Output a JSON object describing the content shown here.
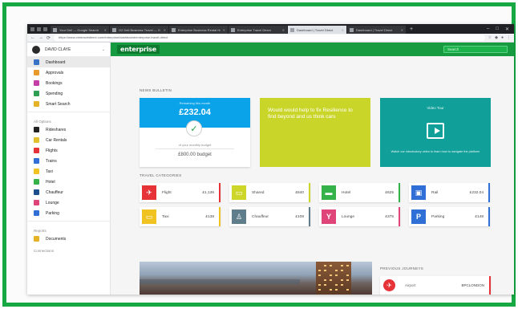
{
  "browser": {
    "tabs": [
      {
        "title": "Your Dell — Google Search",
        "active": false
      },
      {
        "title": "G2 Dell Business Travel — G",
        "active": false
      },
      {
        "title": "Enterprise Business Rental Home",
        "active": false
      },
      {
        "title": "Enterprise Travel Direct",
        "active": false
      },
      {
        "title": "Dashboard | Travel Direct",
        "active": true
      },
      {
        "title": "Dashboard | Travel Direct",
        "active": false
      }
    ],
    "url": "https://www.ctmtraveldirect.com/enterprise/dashboard/enterprise-travel-direct"
  },
  "sidebar": {
    "user_name": "DAVID CLAYE",
    "items": [
      {
        "label": "Dashboard",
        "icon": "dashboard-icon",
        "color": "#3a73c6",
        "active": true
      },
      {
        "label": "Approvals",
        "icon": "approvals-icon",
        "color": "#e89a2a",
        "active": false
      },
      {
        "label": "Bookings",
        "icon": "bookings-icon",
        "color": "#c53ea8",
        "active": false
      },
      {
        "label": "Spending",
        "icon": "spending-icon",
        "color": "#2f9f52",
        "active": false
      },
      {
        "label": "Smart Search",
        "icon": "smart-search-icon",
        "color": "#e6b326",
        "active": false
      }
    ],
    "section_heading": "All Options",
    "options": [
      {
        "label": "Rideshares",
        "icon": "car-icon",
        "color": "#222222"
      },
      {
        "label": "Car Rentals",
        "icon": "car-rental-icon",
        "color": "#e2c02f"
      },
      {
        "label": "Flights",
        "icon": "flight-icon",
        "color": "#e53338"
      },
      {
        "label": "Trains",
        "icon": "train-icon",
        "color": "#2f6fd6"
      },
      {
        "label": "Taxi",
        "icon": "taxi-icon",
        "color": "#f0c323"
      },
      {
        "label": "Hotel",
        "icon": "hotel-icon",
        "color": "#35b24a"
      },
      {
        "label": "Chauffeur",
        "icon": "chauffeur-icon",
        "color": "#1d4f8e"
      },
      {
        "label": "Lounge",
        "icon": "lounge-icon",
        "color": "#e0457a"
      },
      {
        "label": "Parking",
        "icon": "parking-icon",
        "color": "#2f6fd6"
      }
    ],
    "footer_heading": "Reports",
    "footer_items": [
      {
        "label": "Documents",
        "icon": "documents-icon",
        "color": "#e6b326"
      }
    ],
    "bottom_heading": "Connections"
  },
  "topbar": {
    "brand": "enterprise",
    "search_placeholder": "Search"
  },
  "main": {
    "overview_title": "NEWS BULLETIN",
    "budget": {
      "label": "Remaining this month",
      "amount": "£232.04",
      "sub": "of your monthly budget",
      "total": "£800.00 budget"
    },
    "promo_text": "Would would help to fix Resilience to find beyond and us think cars",
    "video": {
      "title": "Video Tour",
      "caption": "Watch our introductory video to learn how to navigate the platform"
    },
    "travel_title": "TRAVEL CATEGORIES",
    "categories": [
      {
        "name": "Flight",
        "value": "£1,136",
        "color": "#e53338",
        "icon": "airplane-icon",
        "glyph": "✈"
      },
      {
        "name": "Shared",
        "value": "£840",
        "color": "#cfd62a",
        "icon": "shared-icon",
        "glyph": "▭"
      },
      {
        "name": "Hotel",
        "value": "£625",
        "color": "#35b24a",
        "icon": "hotel-icon",
        "glyph": "▬"
      },
      {
        "name": "Rail",
        "value": "£232.04",
        "color": "#2f6fd6",
        "icon": "train-icon",
        "glyph": "▣"
      },
      {
        "name": "Taxi",
        "value": "£138",
        "color": "#f0c323",
        "icon": "taxi-icon",
        "glyph": "▭"
      },
      {
        "name": "Chauffeur",
        "value": "£108",
        "color": "#607d8b",
        "icon": "chauffeur-icon",
        "glyph": "♙"
      },
      {
        "name": "Lounge",
        "value": "£375",
        "color": "#e0457a",
        "icon": "lounge-icon",
        "glyph": "Y"
      },
      {
        "name": "Parking",
        "value": "£148",
        "color": "#2f6fd6",
        "icon": "parking-icon",
        "glyph": "P"
      }
    ],
    "recent_title": "PREVIOUS JOURNEYS",
    "recent": [
      {
        "name": "Airport",
        "value": "BPCLONDON",
        "icon": "airplane-icon",
        "glyph": "✈"
      }
    ]
  }
}
